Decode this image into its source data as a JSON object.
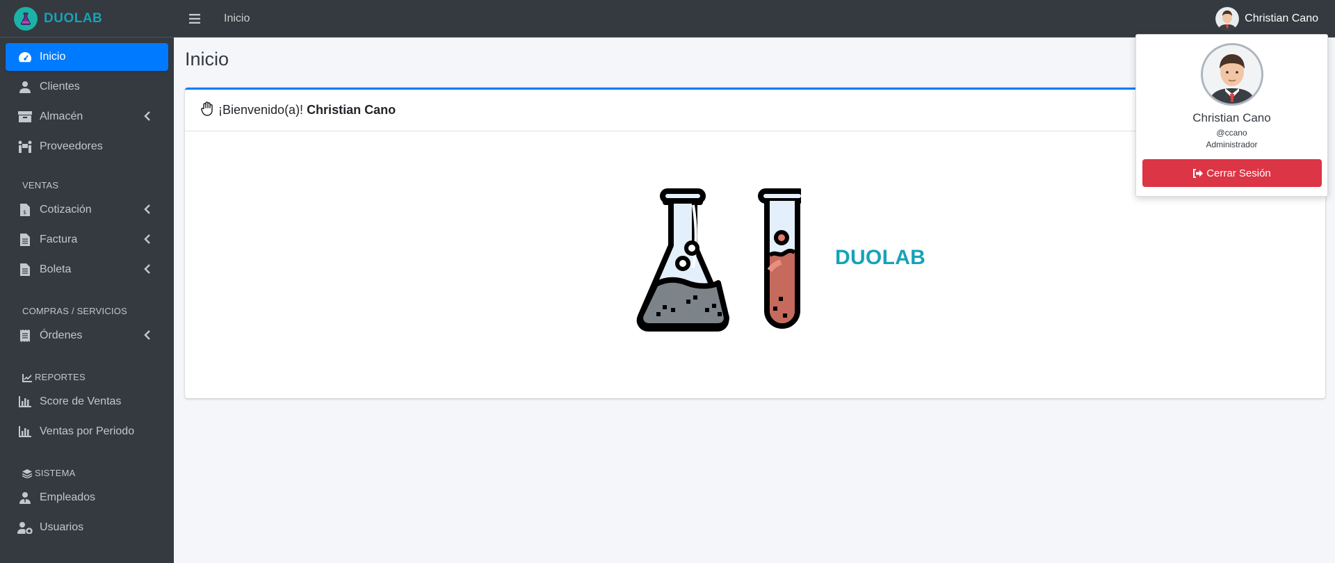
{
  "brand": {
    "name": "DUOLAB"
  },
  "topbar": {
    "breadcrumb": "Inicio",
    "user_name": "Christian Cano"
  },
  "sidebar": {
    "items_main": [
      {
        "label": "Inicio",
        "icon": "tachometer-icon",
        "active": true
      },
      {
        "label": "Clientes",
        "icon": "user-icon"
      },
      {
        "label": "Almacén",
        "icon": "box-icon",
        "has_submenu": true
      },
      {
        "label": "Proveedores",
        "icon": "people-carry-icon"
      }
    ],
    "header_ventas": "VENTAS",
    "items_ventas": [
      {
        "label": "Cotización",
        "icon": "invoice-dollar-icon",
        "has_submenu": true
      },
      {
        "label": "Factura",
        "icon": "file-text-icon",
        "has_submenu": true
      },
      {
        "label": "Boleta",
        "icon": "file-text-icon",
        "has_submenu": true
      }
    ],
    "header_compras": "COMPRAS / SERVICIOS",
    "items_compras": [
      {
        "label": "Órdenes",
        "icon": "receipt-icon",
        "has_submenu": true
      }
    ],
    "header_reportes": "REPORTES",
    "items_reportes": [
      {
        "label": "Score de Ventas",
        "icon": "bar-chart-icon"
      },
      {
        "label": "Ventas por Periodo",
        "icon": "bar-chart-icon"
      }
    ],
    "header_sistema": "SISTEMA",
    "items_sistema": [
      {
        "label": "Empleados",
        "icon": "user-tie-icon"
      },
      {
        "label": "Usuarios",
        "icon": "users-cog-icon"
      }
    ]
  },
  "main": {
    "page_title": "Inicio",
    "welcome_prefix": "¡Bienvenido(a)!",
    "welcome_name": "Christian Cano",
    "brand_big": "DUOLAB"
  },
  "dropdown": {
    "name": "Christian Cano",
    "username": "@ccano",
    "role": "Administrador",
    "logout_label": "Cerrar Sesión"
  },
  "colors": {
    "sidebar_bg": "#343a40",
    "active": "#007bff",
    "brand": "#17a2b8",
    "danger": "#dc3545",
    "content_bg": "#f4f6f9"
  }
}
